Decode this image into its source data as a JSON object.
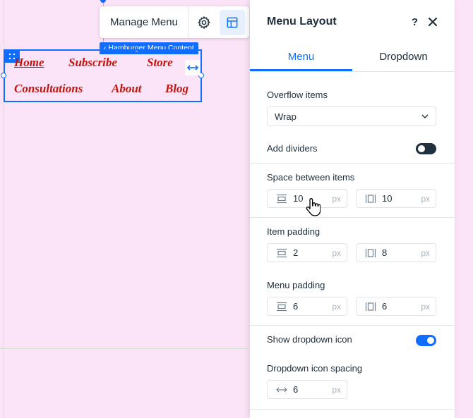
{
  "toolbar": {
    "manage_menu_label": "Manage Menu",
    "settings_icon": "gear-icon",
    "layout_icon": "layout-icon"
  },
  "selection": {
    "tag_label": "Hamburger Menu Content"
  },
  "menu_items": [
    "Home",
    "Subscribe",
    "Store",
    "Consultations",
    "About",
    "Blog"
  ],
  "colors": {
    "accent": "#116dff",
    "menu_text": "#c4130d",
    "canvas": "#fbe4f7"
  },
  "panel": {
    "title": "Menu Layout",
    "help_label": "?",
    "tabs": [
      "Menu",
      "Dropdown"
    ],
    "active_tab": "Menu",
    "overflow": {
      "label": "Overflow items",
      "value": "Wrap"
    },
    "dividers": {
      "label": "Add dividers",
      "enabled": false
    },
    "space_between": {
      "label": "Space between items",
      "vertical": "10",
      "horizontal": "10",
      "unit": "px"
    },
    "item_padding": {
      "label": "Item padding",
      "vertical": "2",
      "horizontal": "8",
      "unit": "px"
    },
    "menu_padding": {
      "label": "Menu padding",
      "vertical": "6",
      "horizontal": "6",
      "unit": "px"
    },
    "dropdown_icon": {
      "label": "Show dropdown icon",
      "enabled": true
    },
    "dropdown_spacing": {
      "label": "Dropdown icon spacing",
      "value": "6",
      "unit": "px"
    }
  }
}
